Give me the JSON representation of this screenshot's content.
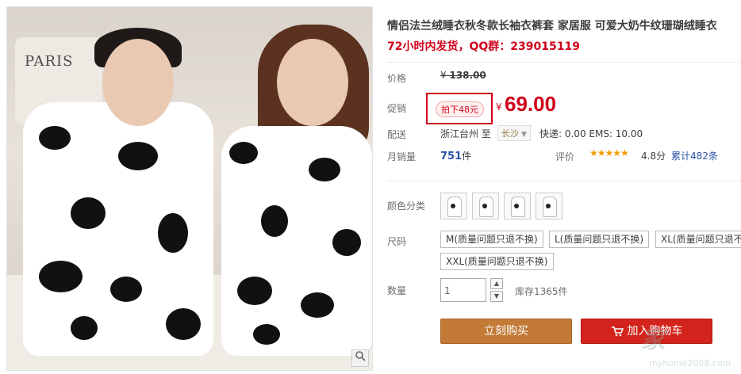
{
  "product": {
    "title": "情侣法兰绒睡衣秋冬款长袖衣裤套 家居服 可爱大奶牛纹珊瑚绒睡衣",
    "subtitle": "72小时内发货，QQ群：239015119"
  },
  "photo": {
    "pillow_text": "PARIS",
    "zoom_icon": "magnifier-icon"
  },
  "price": {
    "label": "价格",
    "currency": "¥",
    "original": "138.00",
    "promo_label": "促销",
    "promo_tag": "拍下48元",
    "sale_currency": "¥",
    "sale": "69.00"
  },
  "shipping": {
    "label": "配送",
    "from": "浙江台州 至",
    "to": "长沙",
    "fee": "快递: 0.00 EMS: 10.00"
  },
  "sales": {
    "label": "月销量",
    "count": "751",
    "unit": "件",
    "rating_label": "评价",
    "stars": "★★★★★",
    "score": "4.8分",
    "reviews": "累计482条"
  },
  "options": {
    "color_label": "颜色分类",
    "size_label": "尺码",
    "sizes": [
      "M(质量问题只退不换)",
      "L(质量问题只退不换)",
      "XL(质量问题只退不换)",
      "XXL(质量问题只退不换)"
    ],
    "qty_label": "数量",
    "qty_value": "1",
    "stock": "库存1365件"
  },
  "actions": {
    "buy": "立刻购买",
    "cart": "加入购物车"
  },
  "watermark": {
    "brand": "家",
    "url": "myhome2008.com"
  },
  "colors": {
    "accent_red": "#d0021b",
    "buy_brown": "#c37a36",
    "cart_red": "#d2241c",
    "link_blue": "#2953a6",
    "star": "#f0a000"
  }
}
